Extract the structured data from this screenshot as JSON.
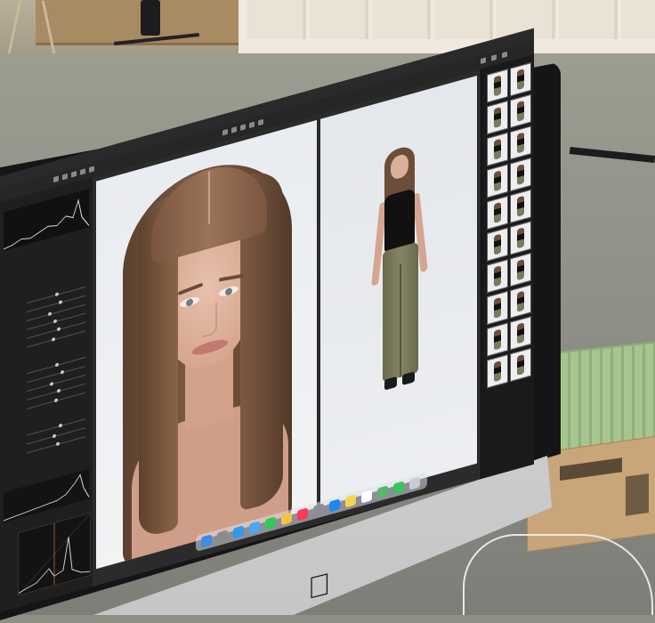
{
  "scene": {
    "device": "iMac",
    "application_window_title": "",
    "left_panel_sections": [
      "",
      "",
      ""
    ],
    "dock_apps": [
      "finder-icon",
      "launchpad-icon",
      "safari-icon",
      "mail-icon",
      "messages-icon",
      "photos-icon",
      "music-icon",
      "settings-icon",
      "appstore-icon",
      "notes-icon",
      "calendar-icon",
      "maps-icon",
      "facetime-icon",
      "trash-icon"
    ]
  },
  "colors": {
    "screen_bg": "#1e1e1f",
    "photo_bg": "#eef0f3",
    "crate": "#a7c58f",
    "box": "#c8a679",
    "bezel": "#151517",
    "chin": "#dcdcdc"
  },
  "filmstrip_count": 20
}
